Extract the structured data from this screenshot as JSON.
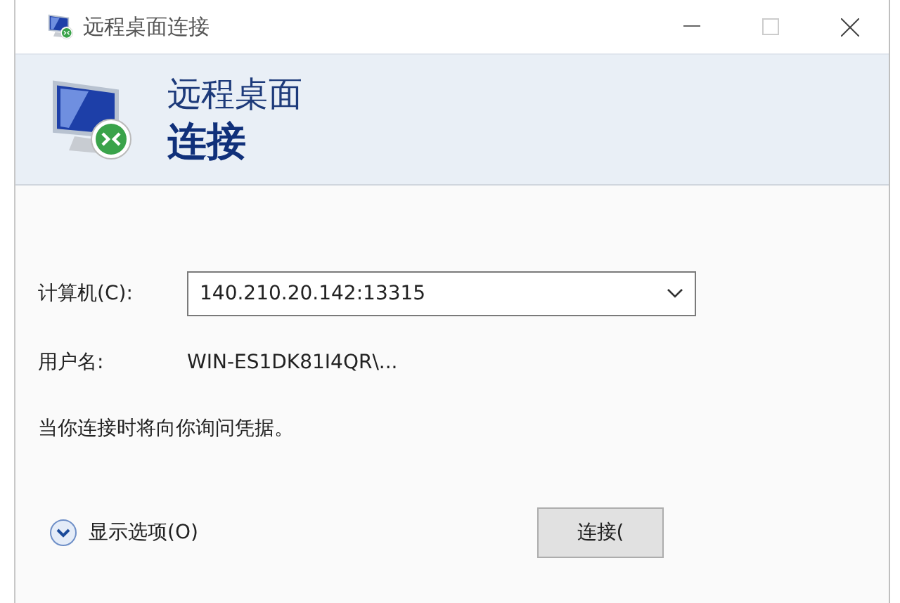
{
  "window": {
    "title": "远程桌面连接"
  },
  "header": {
    "line1": "远程桌面",
    "line2": "连接"
  },
  "fields": [
    {
      "kind": "combo",
      "label": "计算机(C):",
      "value": "140.210.20.142:13315"
    },
    {
      "kind": "text",
      "label": "用户名:",
      "value": "WIN-ES1DK81I4QR\\..."
    }
  ],
  "message": "当你连接时将向你询问凭据。",
  "options": {
    "label": "显示选项(O)",
    "expanded": false
  },
  "buttons": [
    "连接("
  ]
}
